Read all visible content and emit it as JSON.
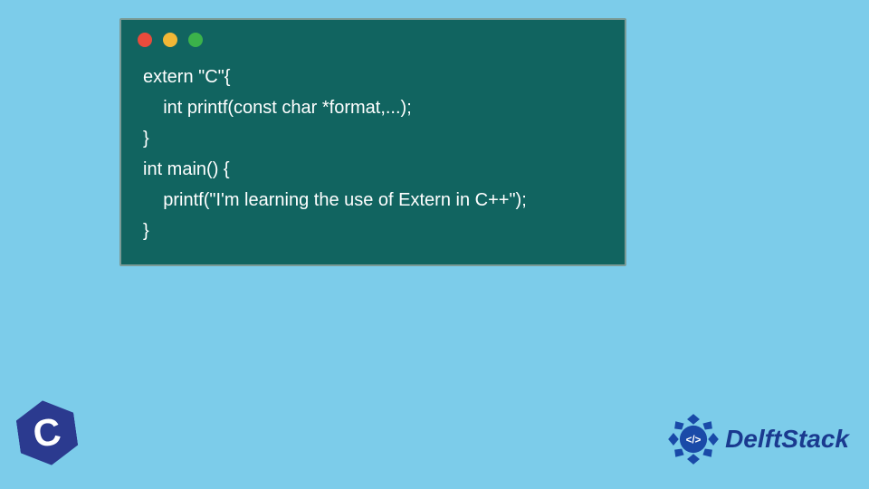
{
  "code": {
    "lines": [
      "extern \"C\"{",
      "    int printf(const char *format,...);",
      "}",
      "int main() {",
      "    printf(\"I'm learning the use of Extern in C++\");",
      "}"
    ]
  },
  "window": {
    "dots": [
      "red",
      "yellow",
      "green"
    ]
  },
  "logo_c": {
    "letter": "C"
  },
  "brand": {
    "name": "DelftStack",
    "icon_label": "</>"
  },
  "colors": {
    "background": "#7cccea",
    "window_bg": "#116460",
    "code_text": "#ffffff",
    "brand_blue": "#1a3a8f",
    "c_logo_bg": "#2b3a8f"
  }
}
